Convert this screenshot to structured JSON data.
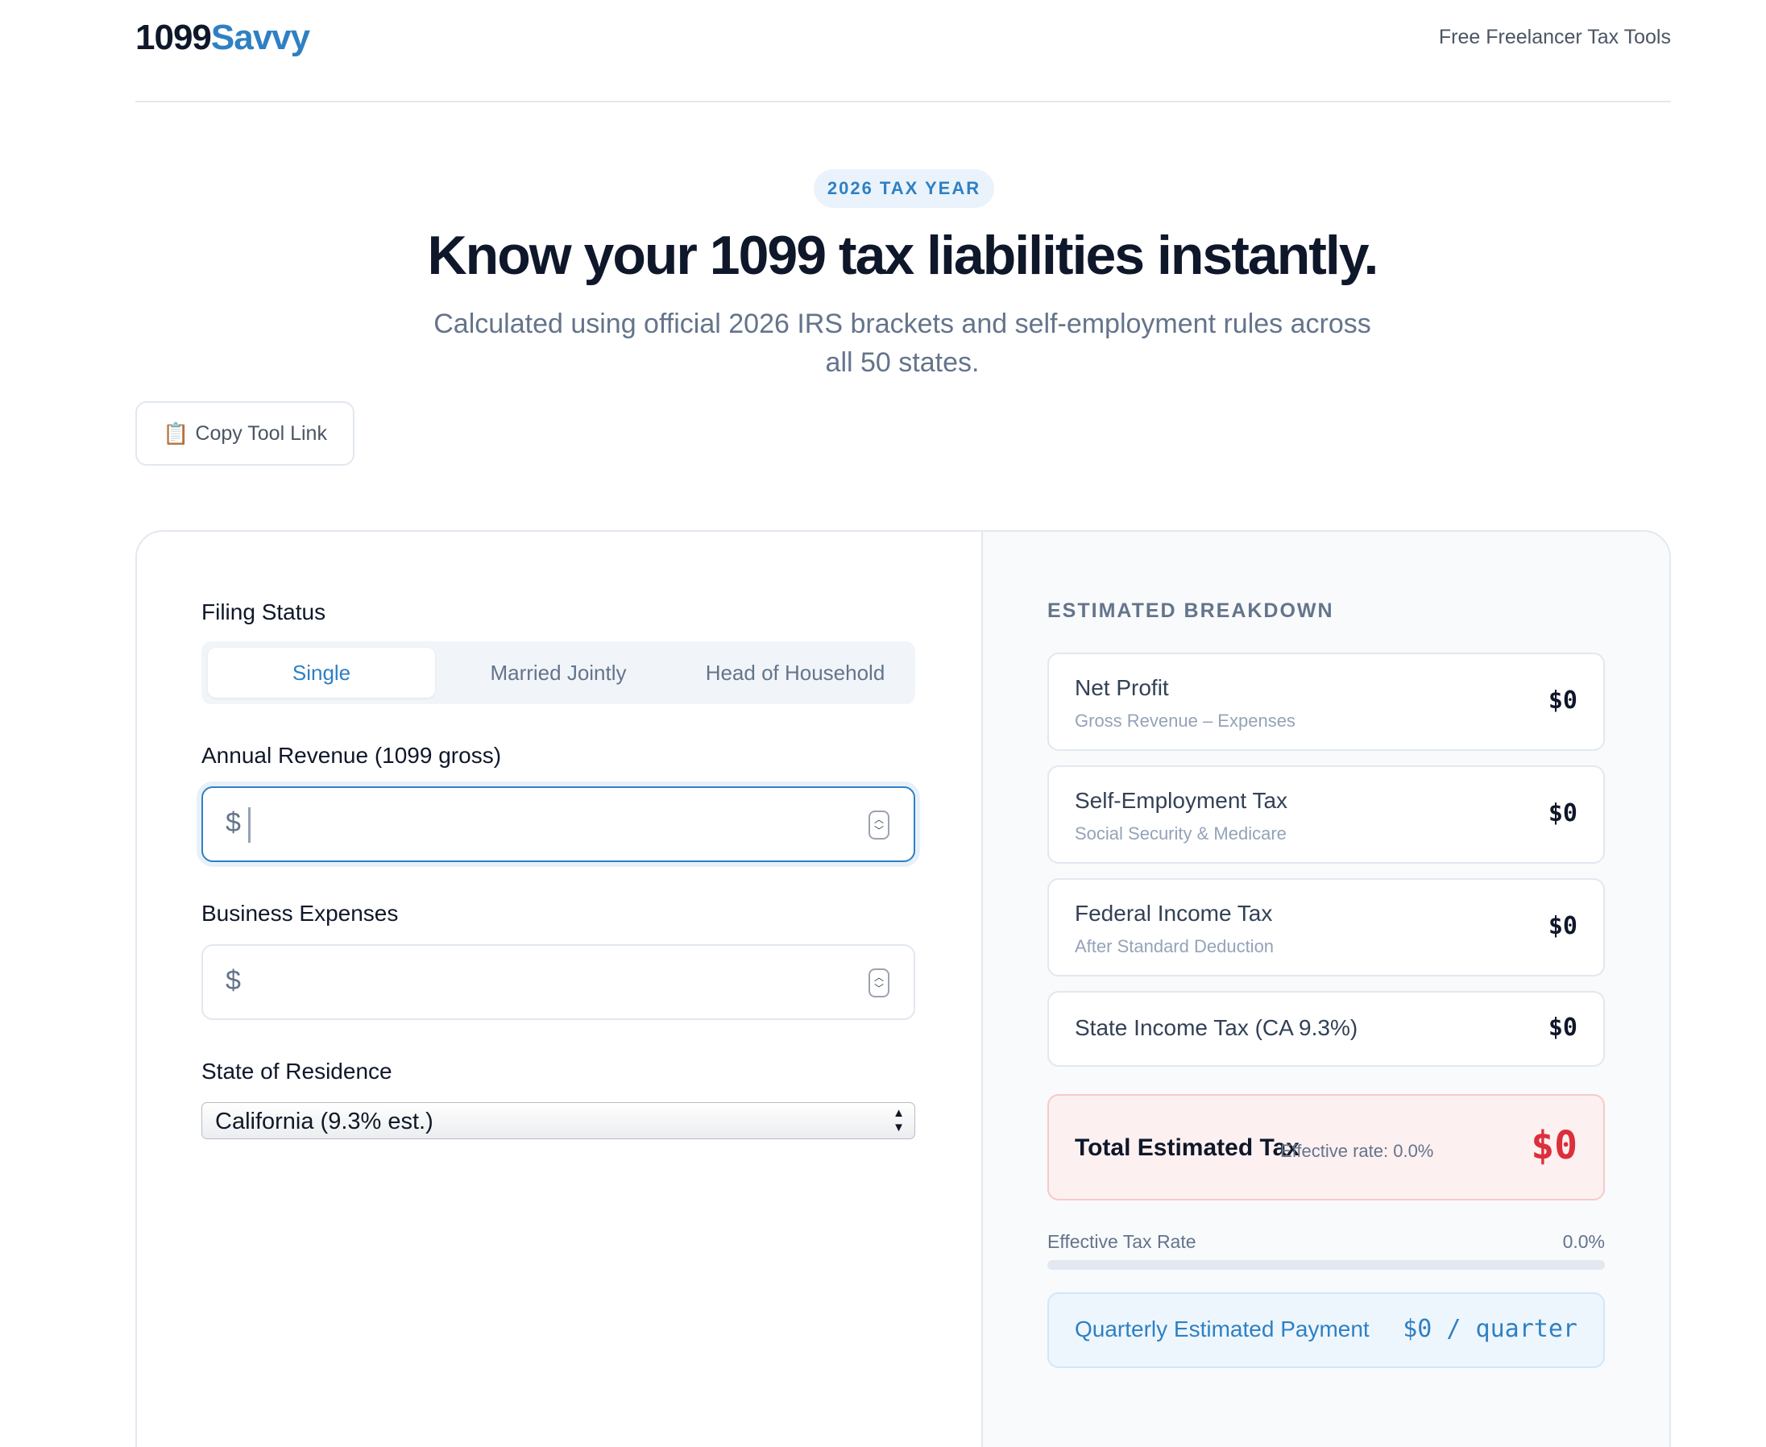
{
  "brand": {
    "name_part1": "1099",
    "name_part2": "Savvy"
  },
  "header": {
    "link": "Free Freelancer Tax Tools"
  },
  "hero": {
    "badge": "2026 TAX YEAR",
    "title": "Know your 1099 tax liabilities instantly.",
    "subtitle": "Calculated using official 2026 IRS brackets and self-employment rules across all 50 states.",
    "copy_icon": "📋",
    "copy_label": "Copy Tool Link"
  },
  "form": {
    "filing_status_label": "Filing Status",
    "filing_options": [
      "Single",
      "Married Jointly",
      "Head of Household"
    ],
    "filing_selected": "Single",
    "revenue_label": "Annual Revenue (1099 gross)",
    "revenue_value": "",
    "expenses_label": "Business Expenses",
    "expenses_value": "",
    "currency_symbol": "$",
    "state_label": "State of Residence",
    "state_value": "California (9.3% est.)"
  },
  "breakdown": {
    "title": "ESTIMATED BREAKDOWN",
    "rows": [
      {
        "title": "Net Profit",
        "sub": "Gross Revenue – Expenses",
        "amount": "$0"
      },
      {
        "title": "Self-Employment Tax",
        "sub": "Social Security & Medicare",
        "amount": "$0"
      },
      {
        "title": "Federal Income Tax",
        "sub": "After Standard Deduction",
        "amount": "$0"
      },
      {
        "title": "State Income Tax (CA 9.3%)",
        "amount": "$0"
      }
    ],
    "total": {
      "title": "Total Estimated Tax",
      "rate_text": "Effective rate: 0.0%",
      "amount": "$0"
    },
    "effective_rate_label": "Effective Tax Rate",
    "effective_rate_value": "0.0%",
    "effective_rate_fraction": 0,
    "quarterly": {
      "title": "Quarterly Estimated Payment",
      "amount": "$0 / quarter"
    }
  },
  "colors": {
    "accent": "#2f80c3",
    "danger": "#dc2f3c",
    "text": "#0f172a",
    "muted": "#64748b"
  }
}
